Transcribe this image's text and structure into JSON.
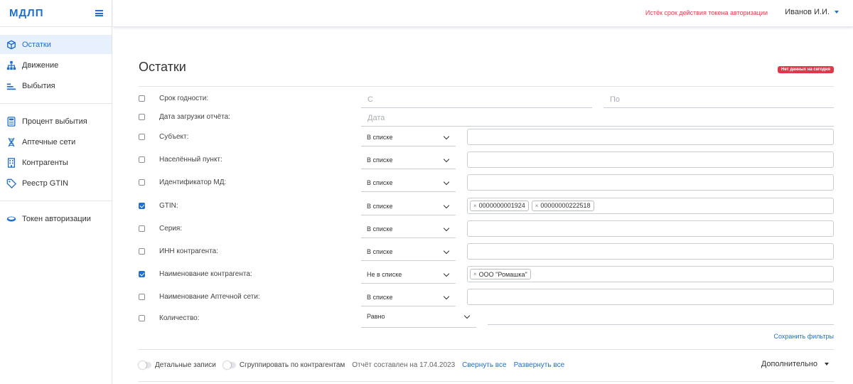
{
  "app": {
    "logo": "МДЛП"
  },
  "sidebar": {
    "groups": [
      [
        {
          "label": "Остатки",
          "icon": "box-icon",
          "active": true
        },
        {
          "label": "Движение",
          "icon": "hierarchy-icon"
        },
        {
          "label": "Выбытия",
          "icon": "bars-icon"
        }
      ],
      [
        {
          "label": "Процент выбытия",
          "icon": "calculator-icon"
        },
        {
          "label": "Аптечные сети",
          "icon": "dna-icon"
        },
        {
          "label": "Контрагенты",
          "icon": "building-icon"
        },
        {
          "label": "Реестр GTIN",
          "icon": "tag-icon"
        }
      ],
      [
        {
          "label": "Токен авторизации",
          "icon": "token-icon"
        }
      ]
    ]
  },
  "header": {
    "token_warning": "Истёк срок действия токена авторизации",
    "user": "Иванов И.И."
  },
  "page": {
    "title": "Остатки",
    "badge": "Нет данных на сегодня"
  },
  "filters": {
    "expiry": {
      "label": "Срок годности:",
      "from_placeholder": "С",
      "to_placeholder": "По"
    },
    "upload_date": {
      "label": "Дата загрузки отчёта:",
      "placeholder": "Дата"
    },
    "rows": [
      {
        "label": "Субъект:",
        "op": "В списке",
        "checked": false,
        "chips": []
      },
      {
        "label": "Населённый пункт:",
        "op": "В списке",
        "checked": false,
        "chips": []
      },
      {
        "label": "Идентификатор МД:",
        "op": "В списке",
        "checked": false,
        "chips": []
      },
      {
        "label": "GTIN:",
        "op": "В списке",
        "checked": true,
        "chips": [
          "0000000001924",
          "00000000222518"
        ]
      },
      {
        "label": "Серия:",
        "op": "В списке",
        "checked": false,
        "chips": []
      },
      {
        "label": "ИНН контрагента:",
        "op": "В списке",
        "checked": false,
        "chips": []
      },
      {
        "label": "Наименование контрагента:",
        "op": "Не в списке",
        "checked": true,
        "chips": [
          "ООО \"Ромашка\""
        ]
      },
      {
        "label": "Наименование Аптечной сети:",
        "op": "В списке",
        "checked": false,
        "chips": []
      }
    ],
    "quantity": {
      "label": "Количество:",
      "op": "Равно"
    },
    "save_label": "Сохранить фильтры"
  },
  "bottom": {
    "detail_label": "Детальные записи",
    "group_label": "Сгруппировать по контрагентам",
    "report_text": "Отчёт составлен на 17.04.2023",
    "collapse": "Свернуть все",
    "expand": "Развернуть все",
    "more": "Дополнительно"
  }
}
